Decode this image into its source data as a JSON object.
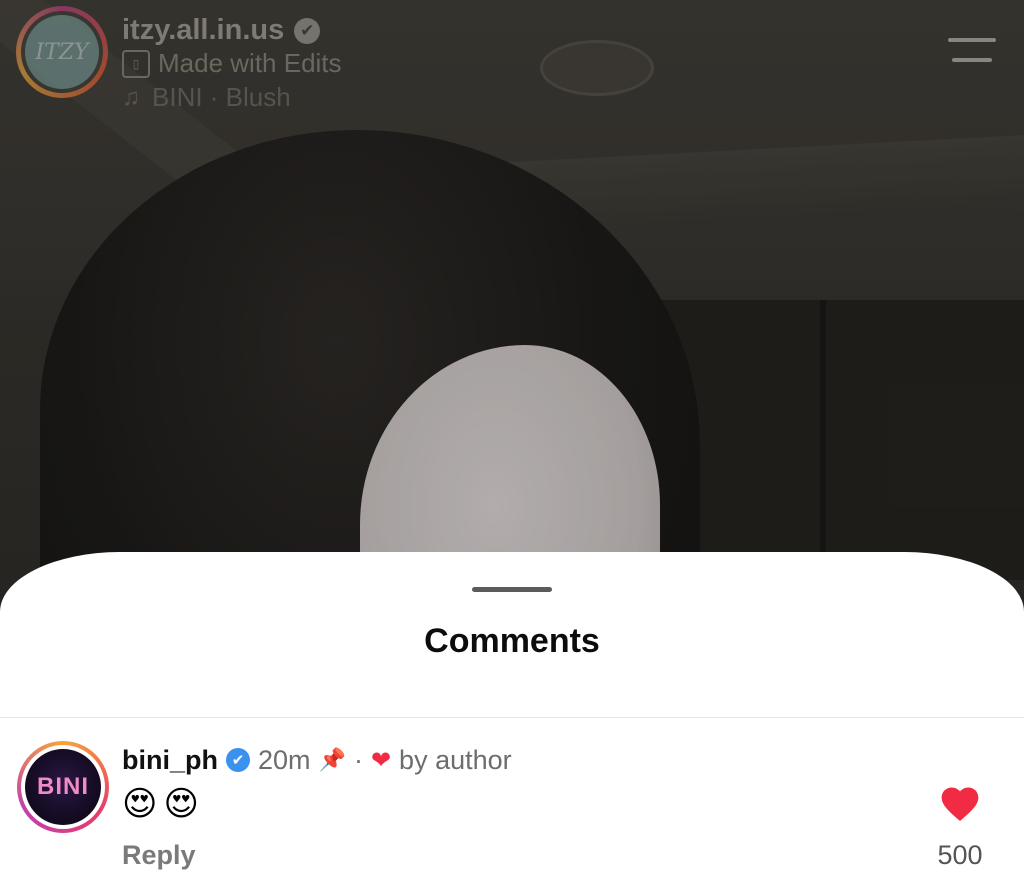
{
  "header": {
    "avatar_text": "ITZY",
    "username": "itzy.all.in.us",
    "verified_glyph": "✔",
    "edits_label": "Made with Edits",
    "music_label": "BINI · Blush",
    "icons": [
      "verified-badge-icon",
      "edits-icon",
      "music-note-icon",
      "menu-icon"
    ]
  },
  "comments_sheet": {
    "title": "Comments",
    "comments": [
      {
        "avatar_text": "BINI",
        "username": "bini_ph",
        "verified_glyph": "✔",
        "time": "20m",
        "pinned": true,
        "separator": "·",
        "liked_by_author_label": "by author",
        "text": "😍😍",
        "reply_label": "Reply",
        "like_count": "500"
      }
    ]
  },
  "colors": {
    "sheet_bg": "#ffffff",
    "verified_blue": "#3a92ef",
    "like_red": "#f02b43"
  }
}
